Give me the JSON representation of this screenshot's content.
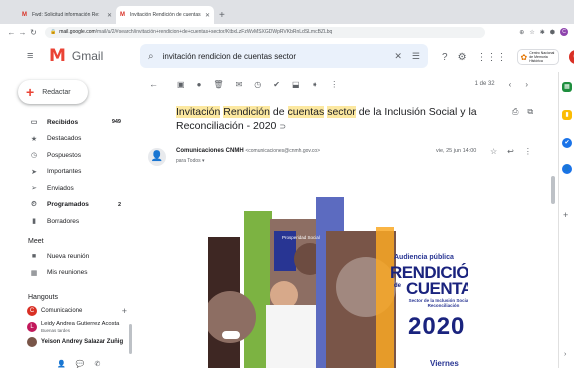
{
  "browser": {
    "tabs": [
      {
        "label": "Fwd: Solicitud información Re:",
        "active": false
      },
      {
        "label": "Invitación Rendición de cuentas",
        "active": true
      }
    ],
    "url_host": "mail.google.com",
    "url_path": "/mail/u/2/#search/invitación+rendicion+de+cuentas+sector/KtbxLzFzWvMSXGDWpRVKbRnLdSLmcBZLbq"
  },
  "header": {
    "app_name": "Gmail",
    "search_query": "invitación rendicion de cuentas sector",
    "org_name": "Centro Nacional de Memoria Histórica",
    "avatar_letter": "C"
  },
  "sidebar": {
    "compose_label": "Redactar",
    "items": [
      {
        "label": "Recibidos",
        "count": "949",
        "icon": "inbox-icon",
        "bold": true
      },
      {
        "label": "Destacados",
        "count": "",
        "icon": "star-icon",
        "bold": false
      },
      {
        "label": "Pospuestos",
        "count": "",
        "icon": "clock-icon",
        "bold": false
      },
      {
        "label": "Importantes",
        "count": "",
        "icon": "important-icon",
        "bold": false
      },
      {
        "label": "Enviados",
        "count": "",
        "icon": "send-icon",
        "bold": false
      },
      {
        "label": "Programados",
        "count": "2",
        "icon": "scheduled-icon",
        "bold": true
      },
      {
        "label": "Borradores",
        "count": "",
        "icon": "draft-icon",
        "bold": false
      }
    ],
    "meet": {
      "title": "Meet",
      "new_meeting": "Nueva reunión",
      "my_meetings": "Mis reuniones"
    },
    "hangouts": {
      "title": "Hangouts",
      "user": "Comunicacione",
      "user_letter": "C",
      "contacts": [
        {
          "name": "Leidy Andrea Gutierrez Acosta",
          "status": "Buenas tardes",
          "letter": "L"
        },
        {
          "name": "Yeison Andrey Salazar Zuñig",
          "status": ""
        }
      ]
    }
  },
  "mail": {
    "pager_text": "1 de 32",
    "subject_parts": [
      {
        "text": "Invitación",
        "hl": true
      },
      {
        "text": " ",
        "hl": false
      },
      {
        "text": "Rendición",
        "hl": true
      },
      {
        "text": " de ",
        "hl": false
      },
      {
        "text": "cuentas",
        "hl": true
      },
      {
        "text": " ",
        "hl": false
      },
      {
        "text": "sector",
        "hl": true
      },
      {
        "text": " de la Inclusión Social y la Reconciliación - 2020",
        "hl": false
      }
    ],
    "sender_name": "Comunicaciones CNMH",
    "sender_email": "<comunicaciones@cnmh.gov.co>",
    "to_line": "para Todos",
    "date": "vie, 25 jun 14:00"
  },
  "poster": {
    "line1": "Audiencia pública",
    "line2": "RENDICIÓN",
    "line3_de": "de",
    "line3": "CUENTAS",
    "sector": "Sector de la Inclusión Social y la Reconciliación",
    "year": "2020",
    "day": "Viernes",
    "photo_tag": "Prosperidad Social"
  },
  "colors": {
    "gmail_red": "#ea4335",
    "search_bg": "#eaf1fb",
    "highlight": "#fce8a0",
    "poster_blue": "#1a237e",
    "poster_green": "#7cb342",
    "poster_yellow": "#f9a825"
  }
}
